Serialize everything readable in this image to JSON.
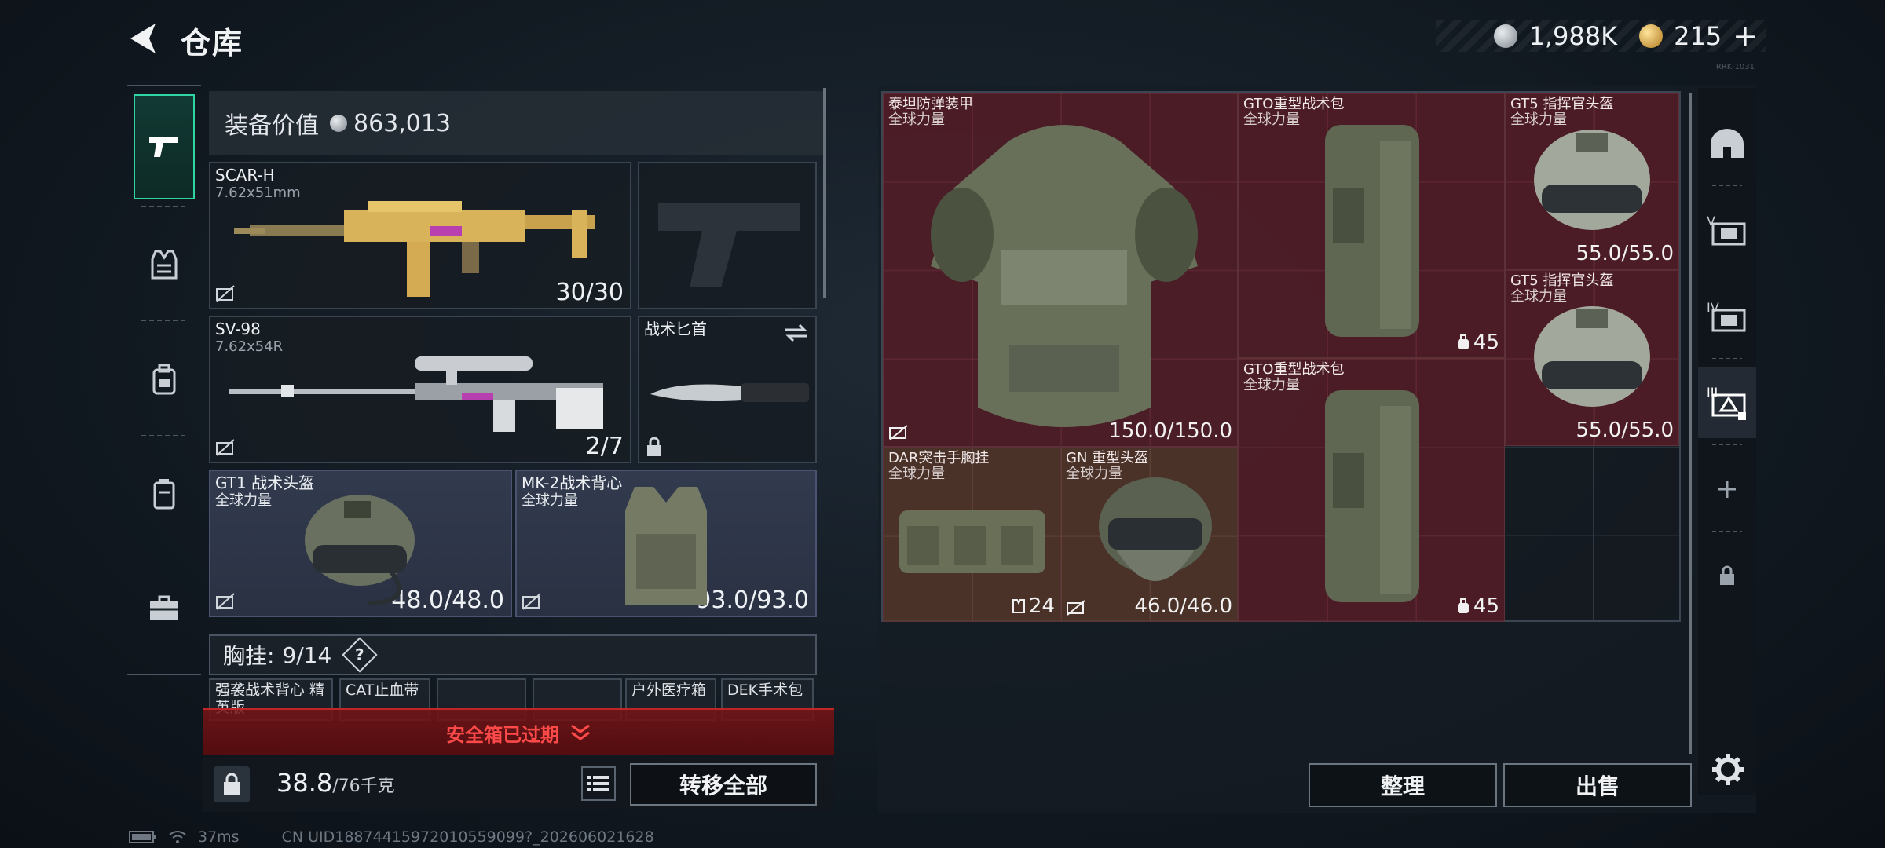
{
  "header": {
    "title": "仓库"
  },
  "currency": {
    "silver": "1,988K",
    "gold": "215",
    "plus": "+",
    "small_code": "RRK·1031"
  },
  "categories": [
    {
      "name": "weapons",
      "icon": "pistol-icon",
      "active": true
    },
    {
      "name": "vest",
      "icon": "vest-icon"
    },
    {
      "name": "backpack",
      "icon": "backpack-icon"
    },
    {
      "name": "container",
      "icon": "canister-icon"
    },
    {
      "name": "toolbox",
      "icon": "briefcase-icon"
    }
  ],
  "loadout": {
    "equip_value_label": "装备价值",
    "equip_value": "863,013",
    "primary": {
      "name": "SCAR-H",
      "caliber": "7.62x51mm",
      "ammo": "30/30"
    },
    "pistol": {
      "name": ""
    },
    "secondary": {
      "name": "SV-98",
      "caliber": "7.62x54R",
      "ammo": "2/7"
    },
    "melee": {
      "name": "战术匕首"
    },
    "helmet": {
      "name": "GT1 战术头盔",
      "faction": "全球力量",
      "durability": "48.0/48.0"
    },
    "armor": {
      "name": "MK-2战术背心",
      "faction": "全球力量",
      "durability": "93.0/93.0"
    },
    "chest_rig_label": "胸挂:",
    "chest_rig_capacity": "9/14",
    "help": "?",
    "pockets": [
      "强袭战术背心 精英版",
      "CAT止血带",
      "",
      "",
      "户外医疗箱",
      "DEK手术包"
    ],
    "safebox_text": "安全箱已过期",
    "weight_current": "38.8",
    "weight_max": "/76千克",
    "transfer_all": "转移全部"
  },
  "storage": {
    "items": [
      {
        "name": "泰坦防弹装甲",
        "faction": "全球力量",
        "value": "150.0/150.0",
        "art": "armor-icon"
      },
      {
        "name": "GTO重型战术包",
        "faction": "全球力量",
        "value": "45",
        "art": "backpack-icon"
      },
      {
        "name": "GT5 指挥官头盔",
        "faction": "全球力量",
        "value": "55.0/55.0",
        "art": "helmet-icon"
      },
      {
        "name": "GT5 指挥官头盔",
        "faction": "全球力量",
        "value": "55.0/55.0",
        "art": "helmet-icon"
      },
      {
        "name": "GTO重型战术包",
        "faction": "全球力量",
        "value": "45",
        "art": "backpack-icon"
      },
      {
        "name": "DAR突击手胸挂",
        "faction": "全球力量",
        "value": "24",
        "art": "chest-rig-icon"
      },
      {
        "name": "GN 重型头盔",
        "faction": "全球力量",
        "value": "46.0/46.0",
        "art": "helmet-icon"
      }
    ],
    "sort_label": "整理",
    "sell_label": "出售",
    "rail": [
      "helmet-icon",
      "armor-v-icon",
      "armor-iv-icon",
      "armor-iii-icon",
      "plus-icon",
      "lock-icon"
    ]
  },
  "status": {
    "ping": "37ms",
    "uid": "CN UID18874415972010559099?_202606021628"
  },
  "colors": {
    "accent": "#2fd6a3",
    "item_red": "#5e1e28",
    "item_brown": "#58382c",
    "warning": "#ff4a4a"
  }
}
